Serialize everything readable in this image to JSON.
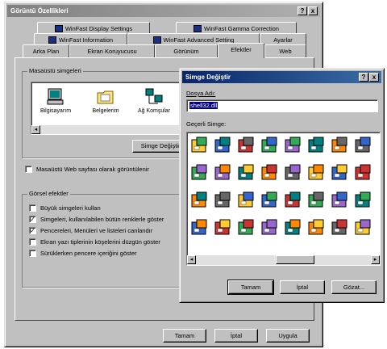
{
  "main_window": {
    "title": "Görüntü Özellikleri",
    "title_buttons": [
      "?",
      "x"
    ],
    "tabs_row1": [
      "WinFast Display Settings",
      "WinFast Gamma Correction"
    ],
    "tabs_row2": [
      "WinFast Information",
      "WinFast Advanced Setting",
      "Ayarlar"
    ],
    "tabs_row3": [
      "Arka Plan",
      "Ekran Koruyucusu",
      "Görünüm",
      "Efektler",
      "Web"
    ],
    "active_tab": "Efektler",
    "desktop_icons_group": {
      "label": "Masaüstü simgeleri",
      "icons": [
        "Bilgisayarım",
        "Belgelerim",
        "Ağ Komşular"
      ]
    },
    "change_icon_button": "Simge Değiştir...",
    "web_checkbox_label": "Masaüstü Web sayfası olarak görüntülenir",
    "visual_effects_group": {
      "label": "Görsel efektler",
      "items": [
        {
          "label": "Büyük simgeleri kullan",
          "checked": false
        },
        {
          "label": "Simgeleri, kullanılabilen bütün renklerle göster",
          "checked": true
        },
        {
          "label": "Pencereleri, Menüleri ve listeleri canlandır",
          "checked": true
        },
        {
          "label": "Ekran yazı tiplerinin köşelerini düzgün göster",
          "checked": false
        },
        {
          "label": "Sürüklerken pencere içeriğini göster",
          "checked": false
        }
      ]
    },
    "footer_buttons": [
      "Tamam",
      "İptal",
      "Uygula"
    ]
  },
  "change_icon_dialog": {
    "title": "Simge Değiştir",
    "title_buttons": [
      "?",
      "x"
    ],
    "file_name_label": "Dosya Adı:",
    "file_name_value": "shell32.dll",
    "current_icon_label": "Geçerli Simge:",
    "icons": [
      [
        "recycle-bin",
        "calendar",
        "cd-player",
        "user-pen",
        "find-file",
        "printer-folder",
        "recycle-full",
        "programs-arrow"
      ],
      [
        "folder-docs",
        "drive-folder",
        "tree",
        "find-computer",
        "monitor-globe",
        "printer",
        "shortcut-folder",
        "folder-open"
      ],
      [
        "pencil-tools",
        "font-folder",
        "notebook",
        "network-globe",
        "computer-search",
        "hand-printer",
        "shared-disk",
        "network-users"
      ],
      [
        "folder-chart",
        "mspaint",
        "small-folder",
        "blank-document",
        "folder-arrow",
        "network-drive",
        "calendar-doc",
        "document-list"
      ]
    ],
    "buttons": [
      "Tamam",
      "İptal",
      "Gözat..."
    ]
  },
  "colors": {
    "title_active": "#0a246a",
    "title_inactive": "#808080",
    "face": "#c0c0c0",
    "selection": "#000080"
  }
}
